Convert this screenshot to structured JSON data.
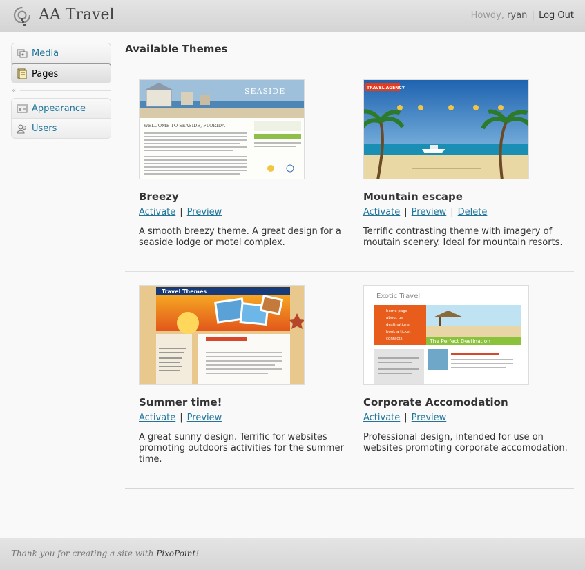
{
  "header": {
    "site_title": "AA Travel",
    "howdy": "Howdy,",
    "user_name": "ryan",
    "separator": "|",
    "logout_label": "Log Out"
  },
  "sidebar": {
    "groups": [
      {
        "items": [
          {
            "label": "Media",
            "icon": "media-icon"
          },
          {
            "label": "Pages",
            "icon": "pages-icon",
            "active": true
          }
        ]
      },
      {
        "items": [
          {
            "label": "Appearance",
            "icon": "appearance-icon"
          },
          {
            "label": "Users",
            "icon": "users-icon"
          }
        ]
      }
    ],
    "collapse_glyph": "«"
  },
  "main": {
    "title": "Available Themes",
    "themes": [
      {
        "name": "Breezy",
        "actions": [
          "Activate",
          "Preview"
        ],
        "description": "A smooth breezy theme. A great design for a seaside lodge or motel complex.",
        "thumb_text": "SEASIDE",
        "thumb_heading": "WELCOME TO SEASIDE, FLORIDA"
      },
      {
        "name": "Mountain escape",
        "actions": [
          "Activate",
          "Preview",
          "Delete"
        ],
        "description": "Terrific contrasting theme with imagery of moutain scenery. Ideal for mountain resorts.",
        "thumb_text": "TRAVEL AGENCY"
      },
      {
        "name": "Summer time!",
        "actions": [
          "Activate",
          "Preview"
        ],
        "description": "A great sunny design. Terrific for websites promoting outdoors activities for the summer time.",
        "thumb_text": "Travel Themes"
      },
      {
        "name": "Corporate Accomodation",
        "actions": [
          "Activate",
          "Preview"
        ],
        "description": "Professional design, intended for use on websites promoting corporate accomodation.",
        "thumb_text": "Exotic Travel",
        "thumb_banner": "The Perfect Destination",
        "thumb_nav": [
          "home page",
          "about us",
          "destinations",
          "book a ticket",
          "contacts"
        ]
      }
    ]
  },
  "footer": {
    "text_before": "Thank you for creating a site with ",
    "brand": "PixoPoint",
    "text_after": "!"
  },
  "colors": {
    "link": "#21759b",
    "header_bg": "#d9d9d9",
    "body_bg": "#f9f9f9"
  }
}
